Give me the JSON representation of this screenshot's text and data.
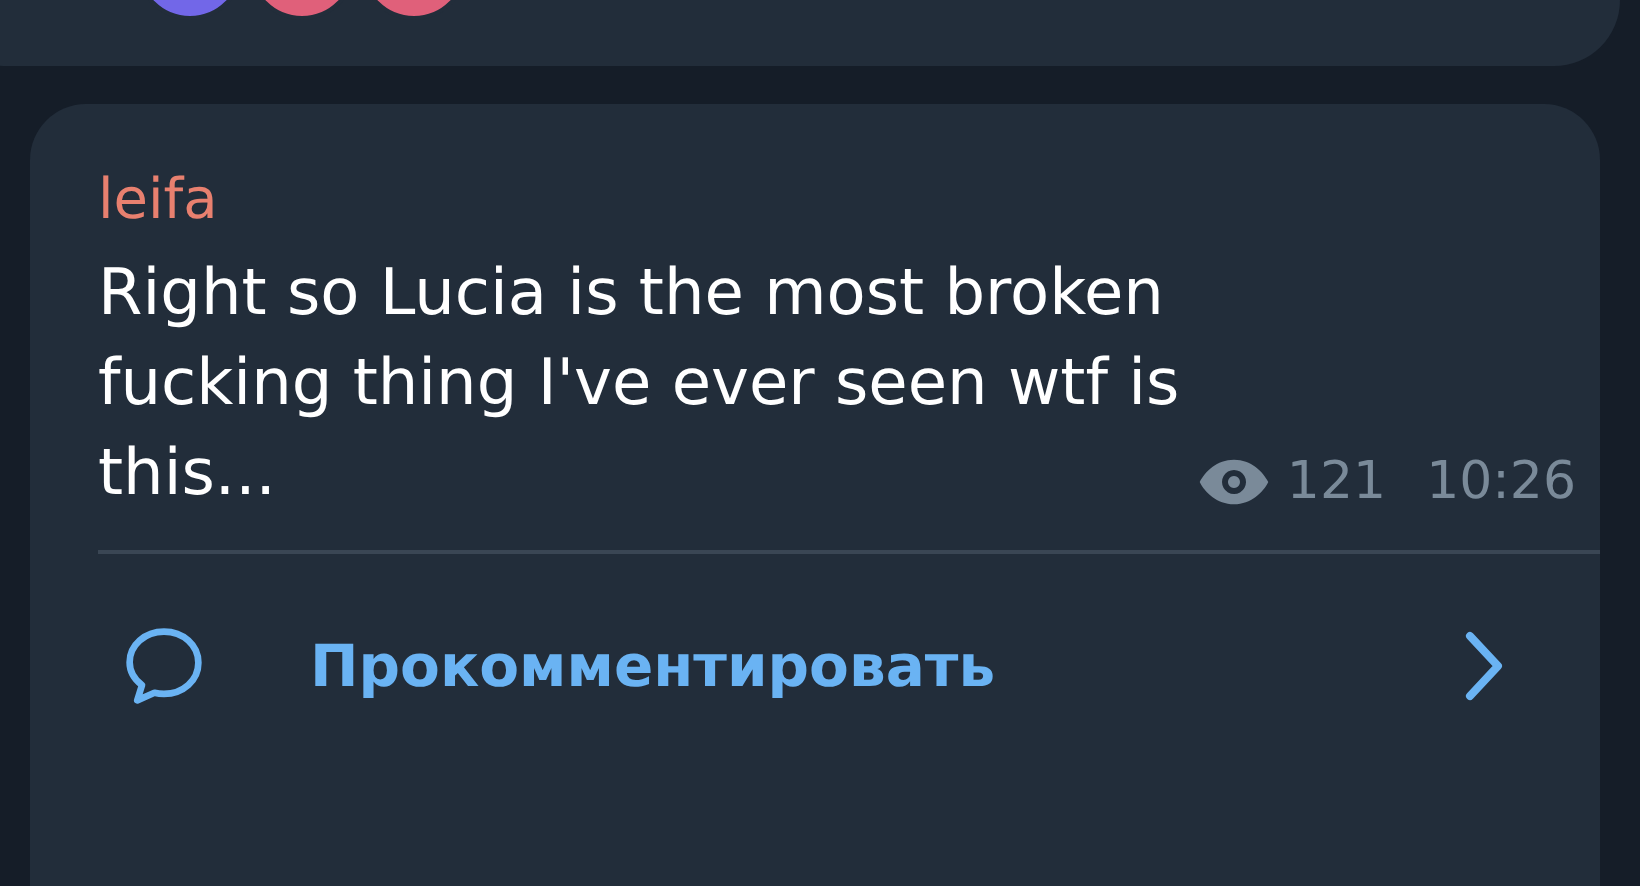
{
  "previous_post": {
    "reactors": [
      {
        "color": "#7267e8"
      },
      {
        "color": "#e0607a"
      },
      {
        "color": "#e0607a"
      }
    ]
  },
  "post": {
    "author": "leifa",
    "text": "Right so Lucia is the most broken fucking thing I've ever seen wtf is this...",
    "views": "121",
    "time": "10:26",
    "comment_label": "Прокомментировать"
  }
}
